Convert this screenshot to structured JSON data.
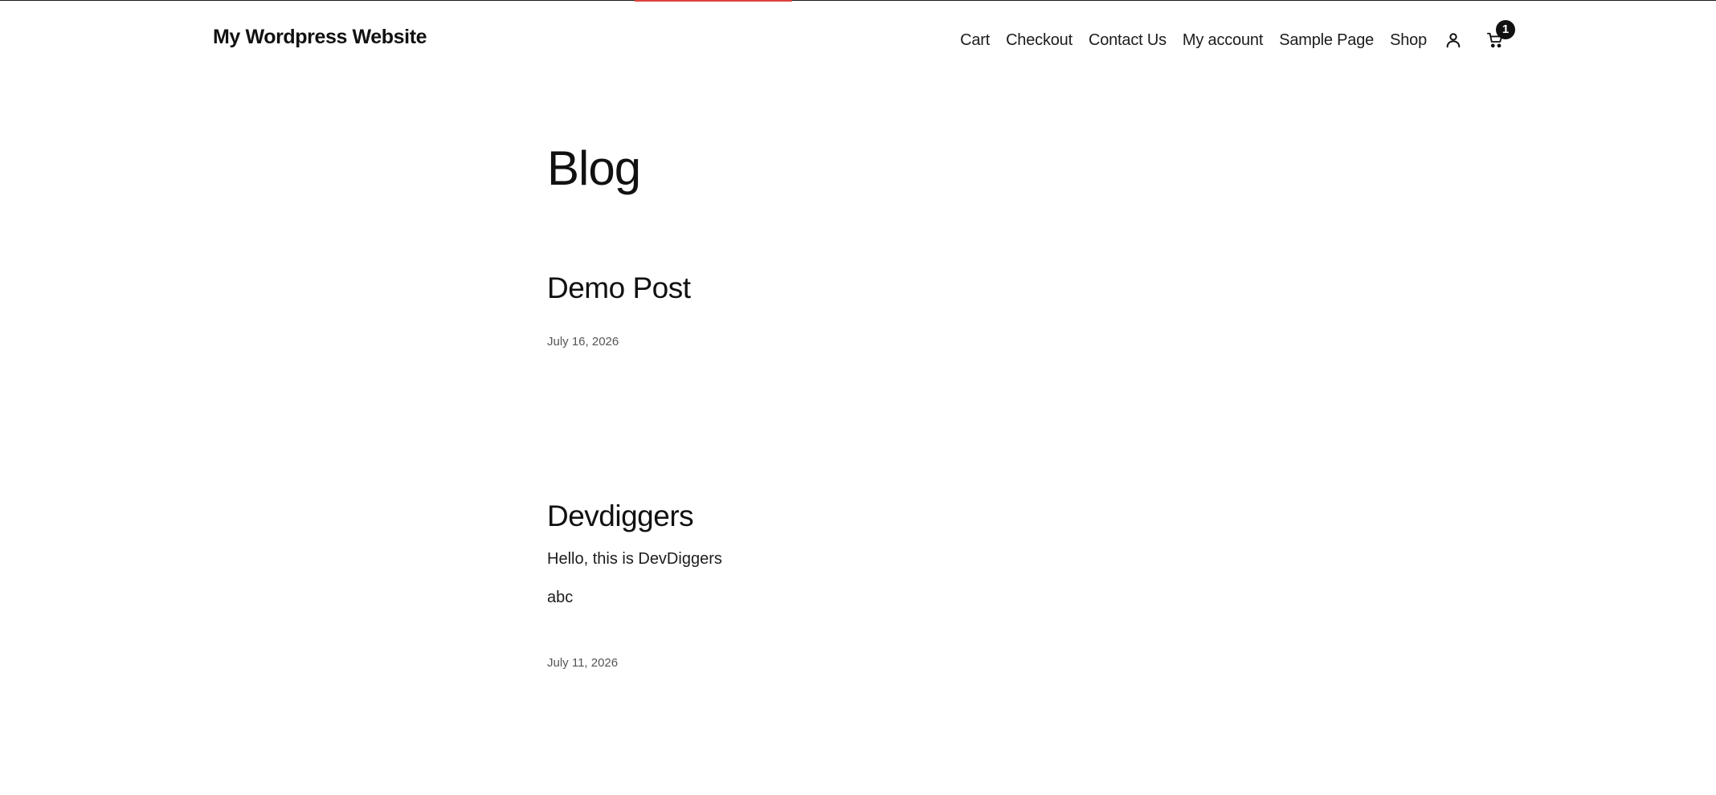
{
  "header": {
    "site_title": "My Wordpress Website",
    "nav": [
      {
        "label": "Cart"
      },
      {
        "label": "Checkout"
      },
      {
        "label": "Contact Us"
      },
      {
        "label": "My account"
      },
      {
        "label": "Sample Page"
      },
      {
        "label": "Shop"
      }
    ],
    "account_icon": "user-icon",
    "cart_icon": "cart-icon",
    "cart_count": "1"
  },
  "main": {
    "page_title": "Blog",
    "posts": [
      {
        "title": "Demo Post",
        "paragraphs": [],
        "date": "July 16, 2026"
      },
      {
        "title": "Devdiggers",
        "paragraphs": [
          "Hello, this is DevDiggers",
          "abc"
        ],
        "date": "July 11, 2026"
      }
    ]
  },
  "colors": {
    "accent": "#e0443e",
    "text": "#111111",
    "muted": "#555555",
    "background": "#ffffff"
  }
}
